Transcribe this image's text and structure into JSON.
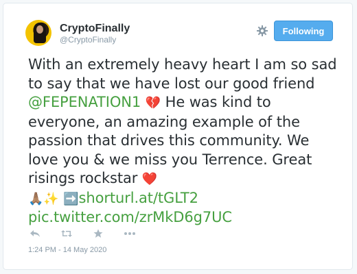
{
  "author": {
    "display_name": "CryptoFinally",
    "handle": "@CryptoFinally"
  },
  "follow_button": {
    "label": "Following"
  },
  "tweet": {
    "text_1": "With an extremely heavy heart I am so sad to say that we have lost our good friend ",
    "mention": "@FEPENATION1",
    "broken_heart": "💔",
    "text_2": " He was kind to everyone, an amazing example of the passion that drives this community. We love you & we miss you Terrence. Great risings rockstar ",
    "red_heart": "❤️",
    "pray": "🙏🏽",
    "sparkles": "✨",
    "arrow": "➡️",
    "link_url": "shorturl.at/tGLT2",
    "pic_url": "pic.twitter.com/zrMkD6g7UC"
  },
  "actions": [
    {
      "icon": "reply-icon"
    },
    {
      "icon": "retweet-icon"
    },
    {
      "icon": "favorite-star-icon"
    },
    {
      "icon": "more-icon"
    }
  ],
  "timestamp": "1:24 PM - 14 May 2020",
  "colors": {
    "accent": "#55acee",
    "link_green": "#46a040",
    "muted": "#8899a6",
    "text": "#292f33"
  }
}
